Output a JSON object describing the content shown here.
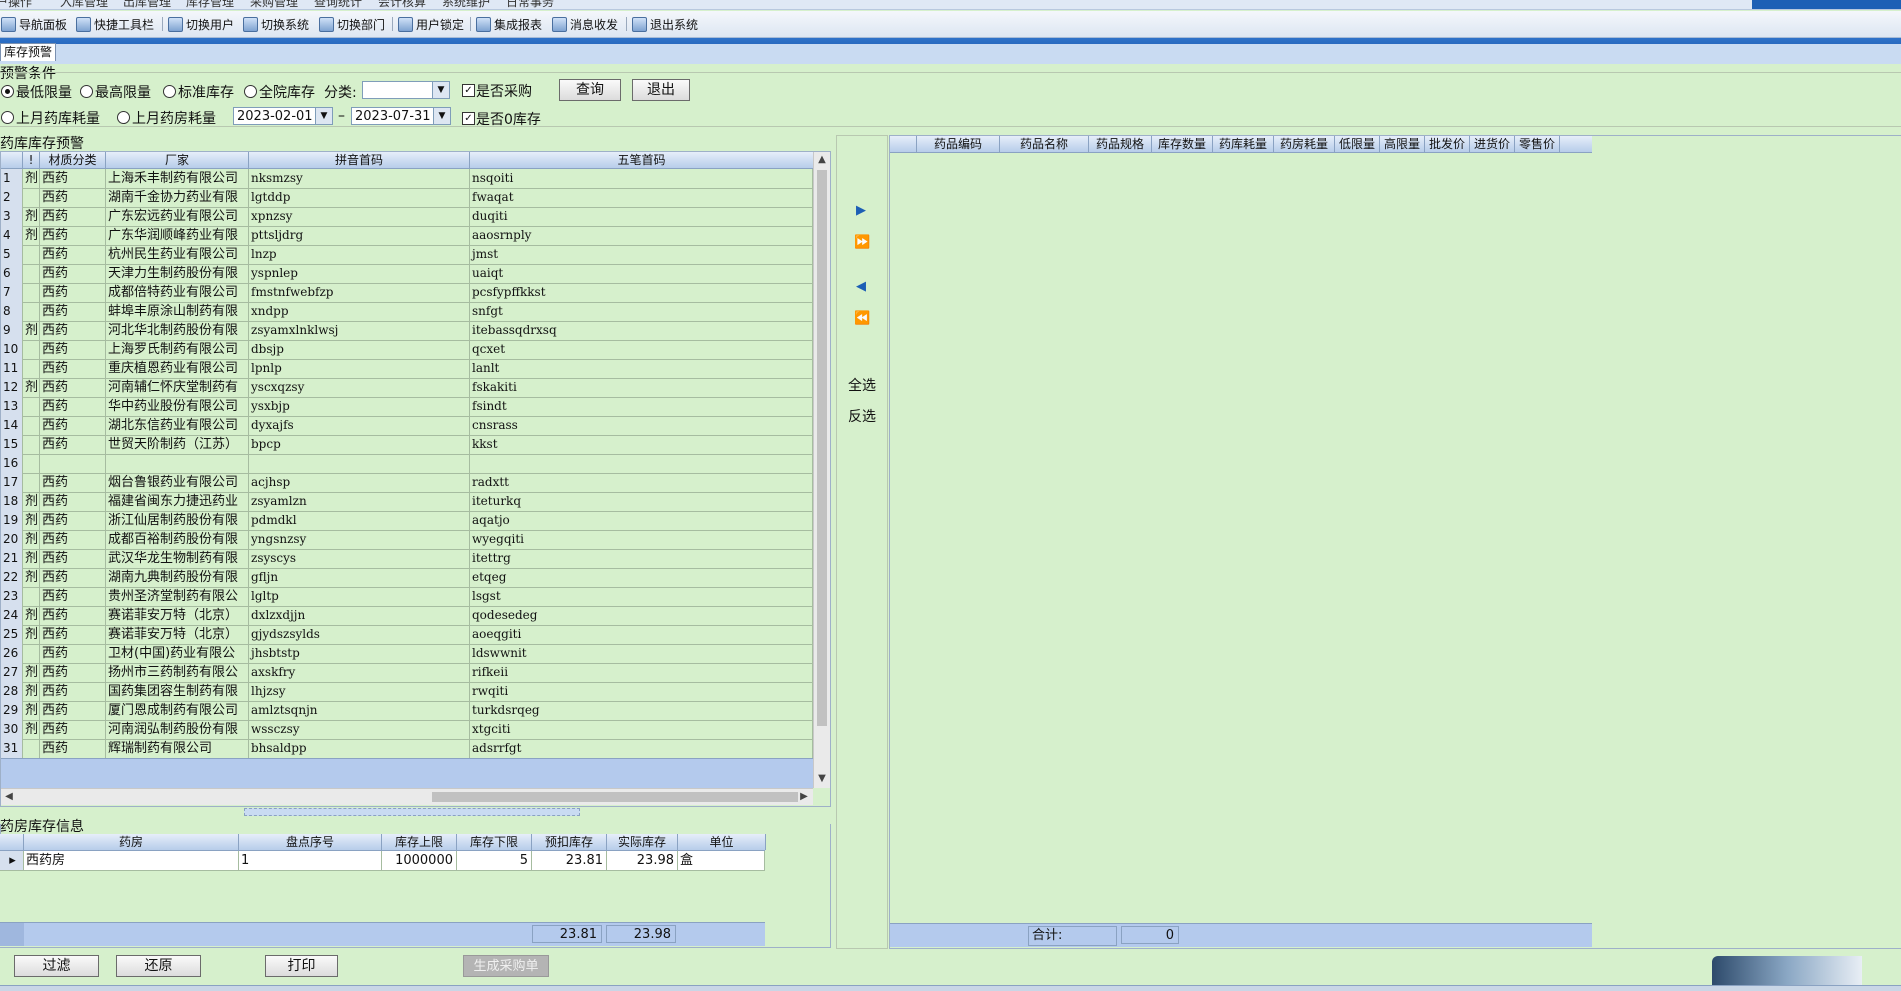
{
  "menu": [
    "户操作",
    "入库管理",
    "出库管理",
    "库存管理",
    "采购管理",
    "查询统计",
    "会计核算",
    "系统维护",
    "日常事务"
  ],
  "toolbar": [
    {
      "label": "导航面板",
      "icon": "nav-panel-icon"
    },
    {
      "label": "快捷工具栏",
      "icon": "quick-toolbar-icon"
    },
    {
      "label": "切换用户",
      "icon": "switch-user-icon"
    },
    {
      "label": "切换系统",
      "icon": "switch-system-icon"
    },
    {
      "label": "切换部门",
      "icon": "switch-dept-icon"
    },
    {
      "label": "用户锁定",
      "icon": "lock-user-icon"
    },
    {
      "label": "集成报表",
      "icon": "report-icon"
    },
    {
      "label": "消息收发",
      "icon": "message-icon"
    },
    {
      "label": "退出系统",
      "icon": "exit-icon"
    }
  ],
  "tab": {
    "active": "库存预警"
  },
  "filter": {
    "group_title": "预警条件",
    "radios_row1": [
      "最低限量",
      "最高限量",
      "标准库存",
      "全院库存"
    ],
    "radios_row2": [
      "上月药库耗量",
      "上月药房耗量"
    ],
    "category_label": "分类:",
    "category_value": "",
    "chk_purchase": "是否采购",
    "chk_zero": "是否0库存",
    "date_from": "2023-02-01",
    "date_sep": "–",
    "date_to": "2023-07-31",
    "query_btn": "查询",
    "exit_btn": "退出"
  },
  "left_grid": {
    "title": "药库库存预警",
    "headers": [
      "",
      "",
      "材质分类",
      "厂家",
      "拼音首码",
      "五笔首码"
    ],
    "rows": [
      {
        "n": "1",
        "c": "剂",
        "type": "西药",
        "maker": "上海禾丰制药有限公司",
        "py": "nksmzsy",
        "wb": "nsqoiti"
      },
      {
        "n": "2",
        "c": "",
        "type": "西药",
        "maker": "湖南千金协力药业有限",
        "py": "lgtddp",
        "wb": "fwaqat"
      },
      {
        "n": "3",
        "c": "剂",
        "type": "西药",
        "maker": "广东宏远药业有限公司",
        "py": "xpnzsy",
        "wb": "duqiti"
      },
      {
        "n": "4",
        "c": "剂",
        "type": "西药",
        "maker": "广东华润顺峰药业有限",
        "py": "pttsljdrg",
        "wb": "aaosrnply"
      },
      {
        "n": "5",
        "c": "",
        "type": "西药",
        "maker": "杭州民生药业有限公司",
        "py": "lnzp",
        "wb": "jmst"
      },
      {
        "n": "6",
        "c": "",
        "type": "西药",
        "maker": "天津力生制药股份有限",
        "py": "yspnlep",
        "wb": "uaiqt"
      },
      {
        "n": "7",
        "c": "",
        "type": "西药",
        "maker": "成都倍特药业有限公司",
        "py": "fmstnfwebfzp",
        "wb": "pcsfypffkkst"
      },
      {
        "n": "8",
        "c": "",
        "type": "西药",
        "maker": "蚌埠丰原涂山制药有限",
        "py": "xndpp",
        "wb": "snfgt"
      },
      {
        "n": "9",
        "c": "剂",
        "type": "西药",
        "maker": "河北华北制药股份有限",
        "py": "zsyamxlnklwsj",
        "wb": "itebassqdrxsq"
      },
      {
        "n": "10",
        "c": "",
        "type": "西药",
        "maker": "上海罗氏制药有限公司",
        "py": "dbsjp",
        "wb": "qcxet"
      },
      {
        "n": "11",
        "c": "",
        "type": "西药",
        "maker": "重庆植恩药业有限公司",
        "py": "lpnlp",
        "wb": "lanlt"
      },
      {
        "n": "12",
        "c": "剂",
        "type": "西药",
        "maker": "河南辅仁怀庆堂制药有",
        "py": "yscxqzsy",
        "wb": "fskakiti"
      },
      {
        "n": "13",
        "c": "",
        "type": "西药",
        "maker": "华中药业股份有限公司",
        "py": "ysxbjp",
        "wb": "fsindt"
      },
      {
        "n": "14",
        "c": "",
        "type": "西药",
        "maker": "湖北东信药业有限公司",
        "py": "dyxajfs",
        "wb": "cnsrass"
      },
      {
        "n": "15",
        "c": "",
        "type": "西药",
        "maker": "世贸天阶制药（江苏）",
        "py": "bpcp",
        "wb": "kkst"
      },
      {
        "n": "16",
        "c": "",
        "type": "",
        "maker": "",
        "py": "",
        "wb": ""
      },
      {
        "n": "17",
        "c": "",
        "type": "西药",
        "maker": "烟台鲁银药业有限公司",
        "py": "acjhsp",
        "wb": "radxtt"
      },
      {
        "n": "18",
        "c": "剂",
        "type": "西药",
        "maker": "福建省闽东力捷迅药业",
        "py": "zsyamlzn",
        "wb": "iteturkq"
      },
      {
        "n": "19",
        "c": "剂",
        "type": "西药",
        "maker": "浙江仙居制药股份有限",
        "py": "pdmdkl",
        "wb": "aqatjo"
      },
      {
        "n": "20",
        "c": "剂",
        "type": "西药",
        "maker": "成都百裕制药股份有限",
        "py": "yngsnzsy",
        "wb": "wyegqiti"
      },
      {
        "n": "21",
        "c": "剂",
        "type": "西药",
        "maker": "武汉华龙生物制药有限",
        "py": "zsyscys",
        "wb": "itettrg"
      },
      {
        "n": "22",
        "c": "剂",
        "type": "西药",
        "maker": "湖南九典制药股份有限",
        "py": "gfljn",
        "wb": "etqeg"
      },
      {
        "n": "23",
        "c": "",
        "type": "西药",
        "maker": "贵州圣济堂制药有限公",
        "py": "lgltp",
        "wb": "lsgst"
      },
      {
        "n": "24",
        "c": "剂",
        "type": "西药",
        "maker": "赛诺菲安万特（北京）",
        "py": "dxlzxdjjn",
        "wb": "qodesedeg"
      },
      {
        "n": "25",
        "c": "剂",
        "type": "西药",
        "maker": "赛诺菲安万特（北京）",
        "py": "gjydszsylds",
        "wb": "aoeqgiti"
      },
      {
        "n": "26",
        "c": "",
        "type": "西药",
        "maker": "卫材(中国)药业有限公",
        "py": "jhsbtstp",
        "wb": "ldswwnit"
      },
      {
        "n": "27",
        "c": "剂",
        "type": "西药",
        "maker": "扬州市三药制药有限公",
        "py": "axskfry",
        "wb": "rifkeii"
      },
      {
        "n": "28",
        "c": "剂",
        "type": "西药",
        "maker": "国药集团容生制药有限",
        "py": "lhjzsy",
        "wb": "rwqiti"
      },
      {
        "n": "29",
        "c": "剂",
        "type": "西药",
        "maker": "厦门恩成制药有限公司",
        "py": "amlztsqnjn",
        "wb": "turkdsrqeg"
      },
      {
        "n": "30",
        "c": "剂",
        "type": "西药",
        "maker": "河南润弘制药股份有限",
        "py": "wssczsy",
        "wb": "xtgciti"
      },
      {
        "n": "31",
        "c": "",
        "type": "西药",
        "maker": "辉瑞制药有限公司",
        "py": "bhsaldpp",
        "wb": "adsrrfgt"
      }
    ]
  },
  "middle": {
    "select_all": "全选",
    "invert": "反选"
  },
  "right_grid": {
    "headers": [
      "药品编码",
      "药品名称",
      "药品规格",
      "库存数量",
      "药库耗量",
      "药房耗量",
      "低限量",
      "高限量",
      "批发价",
      "进货价",
      "零售价"
    ],
    "total_label": "合计:",
    "total_value": "0"
  },
  "pharmacy": {
    "title": "药房库存信息",
    "headers": [
      "药房",
      "盘点序号",
      "库存上限",
      "库存下限",
      "预扣库存",
      "实际库存",
      "单位"
    ],
    "rows": [
      {
        "room": "西药房",
        "seq": "1",
        "upper": "1000000",
        "lower": "5",
        "reserved": "23.81",
        "actual": "23.98",
        "unit": "盒"
      }
    ],
    "sum_reserved": "23.81",
    "sum_actual": "23.98"
  },
  "bottom_buttons": {
    "filter": "过滤",
    "restore": "还原",
    "print": "打印",
    "generate": "生成采购单"
  }
}
